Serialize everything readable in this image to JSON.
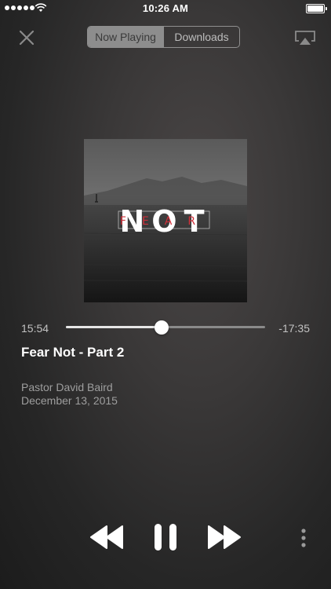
{
  "status_bar": {
    "time": "10:26 AM",
    "signal_icon": "cellular-signal-icon",
    "wifi_icon": "wifi-icon",
    "battery_icon": "battery-icon"
  },
  "header": {
    "close_icon": "close-icon",
    "tabs": [
      {
        "label": "Now Playing",
        "selected": true
      },
      {
        "label": "Downloads",
        "selected": false
      }
    ],
    "airplay_icon": "airplay-icon"
  },
  "artwork": {
    "title_top": "NOT",
    "title_bottom": "FEAR",
    "accent_color": "#d0303a"
  },
  "playback": {
    "elapsed": "15:54",
    "remaining": "-17:35",
    "progress": 0.48
  },
  "track": {
    "title": "Fear Not - Part 2",
    "speaker": "Pastor David Baird",
    "date": "December 13, 2015"
  },
  "controls": {
    "rewind_icon": "rewind-icon",
    "pause_icon": "pause-icon",
    "fast_forward_icon": "fast-forward-icon",
    "more_icon": "more-options-icon"
  }
}
